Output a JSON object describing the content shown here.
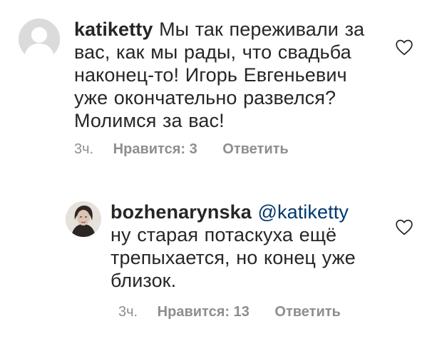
{
  "comments": [
    {
      "username": "katiketty",
      "mention": "",
      "text": " Мы так переживали за вас, как мы рады, что свадьба наконец-то! Игорь Евгеньевич уже окончательно развелся? Молимся за вас!",
      "time": "3ч.",
      "likes": "Нравится: 3",
      "reply": "Ответить"
    },
    {
      "username": "bozhenarynska",
      "mention": " @katiketty",
      "text": " ну старая потаскуха ещё трепыхается, но конец уже близок.",
      "time": "3ч.",
      "likes": "Нравится: 13",
      "reply": "Ответить"
    }
  ],
  "colors": {
    "text": "#262626",
    "meta": "#8e8e8e",
    "mention": "#00376b",
    "avatar_placeholder": "#dbdbdb"
  },
  "icons": [
    "heart-outline-icon",
    "default-avatar-icon"
  ]
}
